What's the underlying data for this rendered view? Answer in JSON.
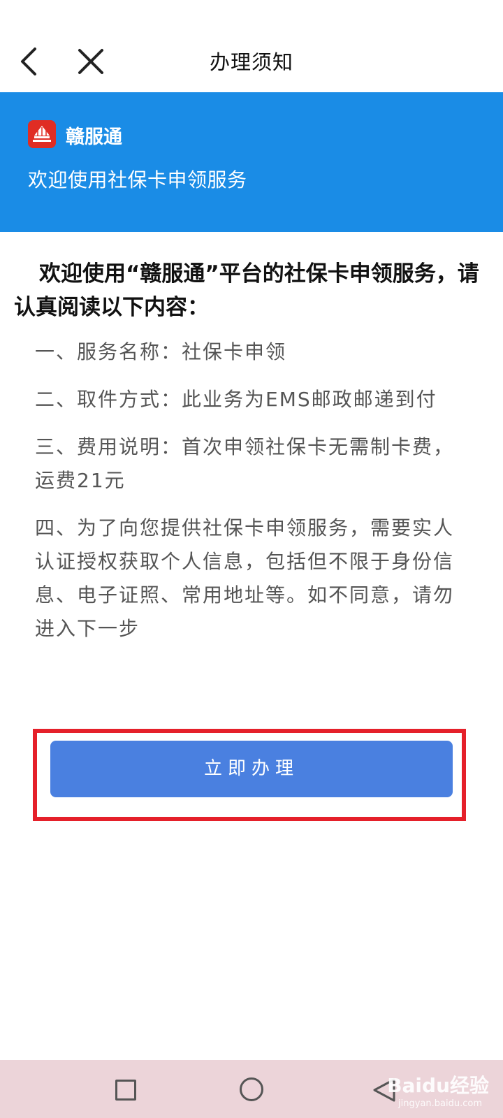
{
  "header": {
    "title": "办理须知"
  },
  "banner": {
    "app_name": "赣服通",
    "subtitle": "欢迎使用社保卡申领服务"
  },
  "content": {
    "intro": "欢迎使用“赣服通”平台的社保卡申领服务，请认真阅读以下内容：",
    "items": [
      "一、服务名称：社保卡申领",
      "二、取件方式：此业务为EMS邮政邮递到付",
      "三、费用说明：首次申领社保卡无需制卡费，运费21元",
      "四、为了向您提供社保卡申领服务，需要实人认证授权获取个人信息，包括但不限于身份信息、电子证照、常用地址等。如不同意，请勿进入下一步"
    ]
  },
  "action": {
    "button_label": "立即办理"
  },
  "watermark": {
    "text": "Baidu经验",
    "sub": "jingyan.baidu.com"
  },
  "colors": {
    "banner": "#1a8ce6",
    "button": "#4a80e0",
    "highlight": "#e5202a"
  },
  "icons": {
    "back": "chevron-left-icon",
    "close": "close-icon",
    "logo": "app-logo-icon",
    "recent": "square-icon",
    "home": "circle-icon",
    "sys_back": "triangle-back-icon"
  }
}
